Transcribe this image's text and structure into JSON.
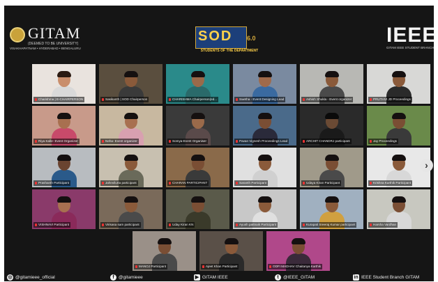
{
  "header": {
    "left_logo": {
      "word": "GITAM",
      "subtitle": "(DEEMED TO BE UNIVERSITY)",
      "cities": "VISAKHAPATNAM • HYDERABAD • BENGALURU"
    },
    "center_logo": {
      "word": "SOD",
      "version": "6.0",
      "caption": "STUDENTS OF THE DEPARTMENT"
    },
    "right_logo": {
      "word": "IEEE",
      "caption": "GITAM IEEE STUDENT BRANCH"
    }
  },
  "participants": [
    {
      "label": "Charishma | E-CHAIRPERSON",
      "bg": "#e9e3de",
      "skin": "#c98e6c",
      "shirt": "#d9d9d9",
      "hair": "#2a1a12"
    },
    {
      "label": "Sasikanth | SOD Chairperson",
      "bg": "#5a4e3e",
      "skin": "#8a5a3a",
      "shirt": "#3a3a3a",
      "hair": "#151010",
      "active": true
    },
    {
      "label": "CHARISHMA Chairperson(ed...",
      "bg": "#2a8a8a",
      "skin": "#9a6a4a",
      "shirt": "#2a6a6a",
      "hair": "#151010"
    },
    {
      "label": "Swetha - Event Designing Lead",
      "bg": "#7a8aa0",
      "skin": "#a06a4a",
      "shirt": "#3a6aa0",
      "hair": "#151010"
    },
    {
      "label": "Ashish Shukla - Event organizer",
      "bg": "#b8b8b4",
      "skin": "#8a5a3a",
      "shirt": "#4a4a4a",
      "hair": "#151010"
    },
    {
      "label": "PRUTHVI JD Proceedings",
      "bg": "#d8d8d6",
      "skin": "#8a5a3a",
      "shirt": "#2a2a2a",
      "hair": "#151010"
    },
    {
      "label": "Riya Kalle- Event Organizer",
      "bg": "#c89a8a",
      "skin": "#a87050",
      "shirt": "#c84a6a",
      "hair": "#151010"
    },
    {
      "label": "Neha- Event organizer",
      "bg": "#c8b8a0",
      "skin": "#a87050",
      "shirt": "#d8a0b0",
      "hair": "#151010"
    },
    {
      "label": "Somya-Event Organiser",
      "bg": "#3a3a3a",
      "skin": "#9a6a4a",
      "shirt": "#5a4a4a",
      "hair": "#151010"
    },
    {
      "label": "Pavan Vignesh Proceedings Lead",
      "bg": "#4a6a8a",
      "skin": "#7a4e34",
      "shirt": "#2a2a3a",
      "hair": "#151010"
    },
    {
      "label": "ARCHIT CHANDRJ participant",
      "bg": "#2a2a2a",
      "skin": "#6a4a34",
      "shirt": "#1a1a1a",
      "hair": "#0a0a0a"
    },
    {
      "label": "Jay Proceedings",
      "bg": "#6a8a4a",
      "skin": "#7a4e34",
      "shirt": "#3a3a3a",
      "hair": "#151010"
    },
    {
      "label": "Prashanth Participant",
      "bg": "#b8bcc0",
      "skin": "#6a4430",
      "shirt": "#2a5a8a",
      "hair": "#151010"
    },
    {
      "label": "Jahnvilurta participant",
      "bg": "#c8c0b0",
      "skin": "#8a5a3a",
      "shirt": "#6a6a5a",
      "hair": "#151010"
    },
    {
      "label": "CHARAN PARTICIPANT",
      "bg": "#8a6a4a",
      "skin": "#7a4e34",
      "shirt": "#3a3a3a",
      "hair": "#151010"
    },
    {
      "label": "Saranth Participant",
      "bg": "#e0e0e0",
      "skin": "#8a5a3a",
      "shirt": "#d0d0d0",
      "hair": "#151010"
    },
    {
      "label": "Udaya Kiran Participant",
      "bg": "#a09a8a",
      "skin": "#7a4e34",
      "shirt": "#4a4a4a",
      "hair": "#151010"
    },
    {
      "label": "Krishna Karthik Participant",
      "bg": "#e8e8e8",
      "skin": "#8a5a3a",
      "shirt": "#d8d8d8",
      "hair": "#151010"
    },
    {
      "label": "VISHNAVI Participant",
      "bg": "#8a3a6a",
      "skin": "#a87050",
      "shirt": "#8a2a5a",
      "hair": "#151010"
    },
    {
      "label": "Virisasa sam participant",
      "bg": "#7a6a5a",
      "skin": "#8a5a3a",
      "shirt": "#4a4a4a",
      "hair": "#151010"
    },
    {
      "label": "Uday Kiran KN",
      "bg": "#5a5a4a",
      "skin": "#7a4e34",
      "shirt": "#3a3a2a",
      "hair": "#151010"
    },
    {
      "label": "Ayush pattnaik Participant",
      "bg": "#c8c8c8",
      "skin": "#8a5a3a",
      "shirt": "#e0e0e0",
      "hair": "#151010"
    },
    {
      "label": "Kurapati Sreeraj Kumar participant",
      "bg": "#a0b0c0",
      "skin": "#8a5a3a",
      "shirt": "#d0a040",
      "hair": "#151010"
    },
    {
      "label": "Harsha Vardhan",
      "bg": "#c8c8c0",
      "skin": "#7a4e34",
      "shirt": "#d8d8d8",
      "hair": "#151010"
    },
    {
      "label": "MANOJ Participant",
      "bg": "#9a9088",
      "skin": "#7a4e34",
      "shirt": "#4a4a4a",
      "hair": "#151010"
    },
    {
      "label": "Ajeet Khan Participant",
      "bg": "#5a5048",
      "skin": "#8a5a3a",
      "shirt": "#2a2a2a",
      "hair": "#151010"
    },
    {
      "label": "ODFI MADHAV Chaitanya Karthik",
      "bg": "#b0488a",
      "skin": "#7a4e34",
      "shirt": "#3a2a3a",
      "hair": "#151010"
    }
  ],
  "next_page_icon": "chevron-right-icon",
  "footer": {
    "instagram": "@gitamieee_official",
    "facebook": "@gitamieee",
    "youtube": "GITAM IEEE",
    "twitter": "@IEEE_GITAM",
    "linkedin": "IEEE Student Branch GITAM"
  }
}
